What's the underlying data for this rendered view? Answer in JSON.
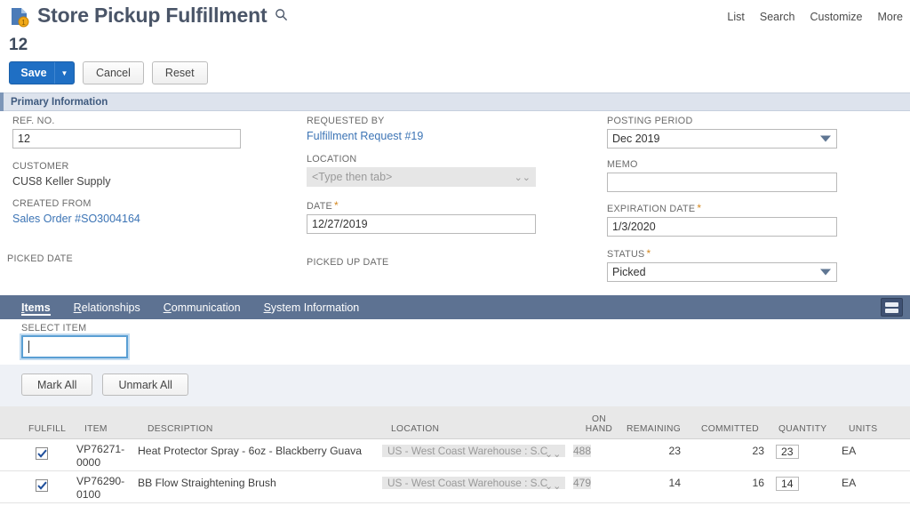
{
  "header": {
    "title": "Store Pickup Fulfillment",
    "doc_icon": "document-badge-icon",
    "search_icon": "magnifier-icon",
    "record_id": "12",
    "nav": [
      {
        "label": "List"
      },
      {
        "label": "Search"
      },
      {
        "label": "Customize"
      },
      {
        "label": "More"
      }
    ]
  },
  "actions": {
    "save_label": "Save",
    "save_caret": "▼",
    "cancel_label": "Cancel",
    "reset_label": "Reset"
  },
  "primary_section": {
    "title": "Primary Information",
    "col1": {
      "ref_no_label": "REF. NO.",
      "ref_no_value": "12",
      "customer_label": "CUSTOMER",
      "customer_value": "CUS8 Keller Supply",
      "created_from_label": "CREATED FROM",
      "created_from_value": "Sales Order #SO3004164",
      "picked_date_label": "PICKED DATE"
    },
    "col2": {
      "requested_by_label": "REQUESTED BY",
      "requested_by_value": "Fulfillment Request #19",
      "location_label": "LOCATION",
      "location_placeholder": "<Type then tab>",
      "date_label": "DATE",
      "date_required": "*",
      "date_value": "12/27/2019",
      "picked_up_date_label": "PICKED UP DATE"
    },
    "col3": {
      "posting_period_label": "POSTING PERIOD",
      "posting_period_value": "Dec 2019",
      "memo_label": "MEMO",
      "memo_value": "",
      "expiration_date_label": "EXPIRATION DATE",
      "expiration_required": "*",
      "expiration_date_value": "1/3/2020",
      "status_label": "STATUS",
      "status_required": "*",
      "status_value": "Picked"
    }
  },
  "tabs": [
    {
      "label": "Items",
      "accel": "I",
      "rest": "tems",
      "active": true
    },
    {
      "label": "Relationships",
      "accel": "R",
      "rest": "elationships",
      "active": false
    },
    {
      "label": "Communication",
      "accel": "C",
      "rest": "ommunication",
      "active": false
    },
    {
      "label": "System Information",
      "accel": "S",
      "rest": "ystem Information",
      "active": false
    }
  ],
  "tab_menu_icon": "list-view-icon",
  "items_panel": {
    "select_item_label": "SELECT ITEM",
    "select_item_value": "",
    "mark_all_label": "Mark All",
    "unmark_all_label": "Unmark All",
    "columns": [
      {
        "key": "fulfill",
        "label": "FULFILL"
      },
      {
        "key": "item",
        "label": "ITEM"
      },
      {
        "key": "description",
        "label": "DESCRIPTION"
      },
      {
        "key": "location",
        "label": "LOCATION"
      },
      {
        "key": "on_hand",
        "label": "ON HAND",
        "line1": "ON",
        "line2": "HAND"
      },
      {
        "key": "remaining",
        "label": "REMAINING"
      },
      {
        "key": "committed",
        "label": "COMMITTED"
      },
      {
        "key": "quantity",
        "label": "QUANTITY"
      },
      {
        "key": "units",
        "label": "UNITS"
      }
    ],
    "rows": [
      {
        "fulfill": true,
        "item_line1": "VP76271-",
        "item_line2": "0000",
        "description": "Heat Protector Spray - 6oz - Blackberry Guava",
        "location": "US - West Coast Warehouse : S.C",
        "on_hand": "488",
        "remaining": "23",
        "committed": "23",
        "quantity": "23",
        "units": "EA"
      },
      {
        "fulfill": true,
        "item_line1": "VP76290-",
        "item_line2": "0100",
        "description": "BB Flow Straightening Brush",
        "location": "US - West Coast Warehouse : S.C",
        "on_hand": "479",
        "remaining": "14",
        "committed": "16",
        "quantity": "14",
        "units": "EA"
      }
    ]
  },
  "colors": {
    "accent_blue": "#1f6fc4",
    "link_blue": "#3c74b5",
    "tabbar": "#5d7292",
    "section_band": "#dde3ed",
    "required_star": "#d4881f"
  }
}
